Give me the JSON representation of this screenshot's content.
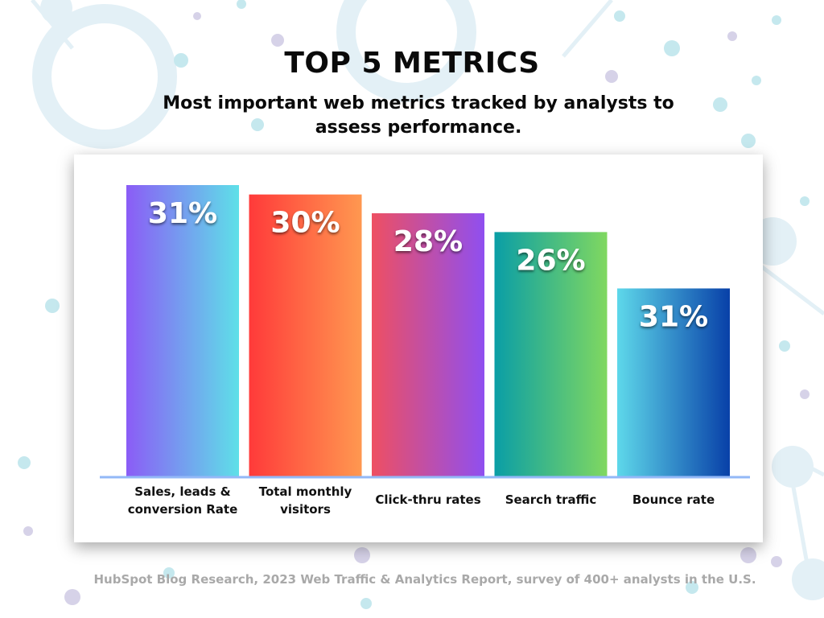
{
  "header": {
    "title": "TOP 5 METRICS",
    "subtitle": "Most important web metrics tracked by analysts to assess performance."
  },
  "footer": {
    "source": "HubSpot Blog Research, 2023 Web Traffic & Analytics Report, survey of 400+ analysts in the U.S."
  },
  "chart_data": {
    "type": "bar",
    "title": "TOP 5 METRICS",
    "subtitle": "Most important web metrics tracked by analysts to assess performance.",
    "categories": [
      [
        "Sales, leads &",
        "conversion Rate"
      ],
      [
        "Total monthly",
        "visitors"
      ],
      [
        "Click-thru rates"
      ],
      [
        "Search traffic"
      ],
      [
        "Bounce rate"
      ]
    ],
    "values": [
      31,
      30,
      28,
      26,
      31
    ],
    "value_labels": [
      "31%",
      "30%",
      "28%",
      "26%",
      "31%"
    ],
    "bar_heights_relative": [
      31,
      30,
      28,
      26,
      20
    ],
    "bar_gradients": [
      [
        "#8b5cf6",
        "#5ee0e8"
      ],
      [
        "#ff3a3a",
        "#ff9850"
      ],
      [
        "#ee4f62",
        "#8f4ff0"
      ],
      [
        "#0a9ea6",
        "#80d860"
      ],
      [
        "#5ed8ea",
        "#0840a8"
      ]
    ],
    "baseline_color": "#93b8f7",
    "grid": false,
    "legend": "none"
  }
}
